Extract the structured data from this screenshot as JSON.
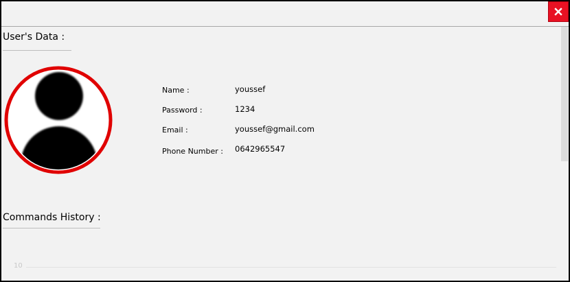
{
  "window": {
    "close_icon": "close-icon",
    "close_color": "#e81123"
  },
  "user_data": {
    "title": "User's Data :",
    "avatar_icon": "user-avatar-icon",
    "avatar_ring_color": "#e00000",
    "fields": [
      {
        "label": "Name :",
        "value": "youssef"
      },
      {
        "label": "Password :",
        "value": "1234"
      },
      {
        "label": "Email :",
        "value": "youssef@gmail.com"
      },
      {
        "label": "Phone Number :",
        "value": "0642965547"
      }
    ]
  },
  "commands_history": {
    "title": "Commands History :",
    "axis_tick": "10"
  }
}
